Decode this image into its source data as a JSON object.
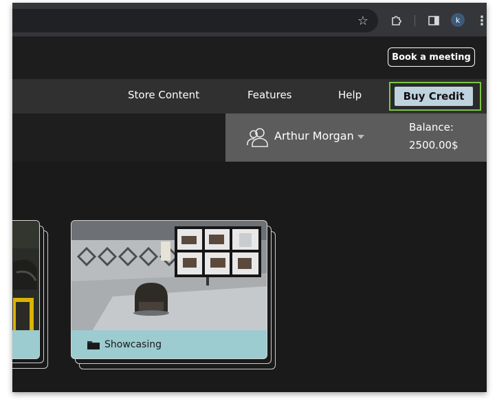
{
  "browser": {
    "star_icon": "star-icon",
    "extensions_icon": "puzzle-icon",
    "side_panel_icon": "side-panel-icon",
    "profile_initial": "k",
    "menu_icon": "kebab-menu-icon"
  },
  "header": {
    "book_meeting_label": "Book a meeting"
  },
  "nav": {
    "items": [
      {
        "label": "Store Content"
      },
      {
        "label": "Features"
      },
      {
        "label": "Help"
      }
    ],
    "buy_credit_label": "Buy Credit",
    "buy_credit_highlight": "#7cc644"
  },
  "user": {
    "name": "Arthur Morgan",
    "balance_label": "Balance:",
    "balance_value": "2500.00$"
  },
  "cards": [
    {
      "label": ""
    },
    {
      "label": "Showcasing"
    }
  ],
  "colors": {
    "card_footer": "#9ccbd0",
    "buy_button": "#bed3de",
    "user_panel": "#5c5c5c"
  }
}
